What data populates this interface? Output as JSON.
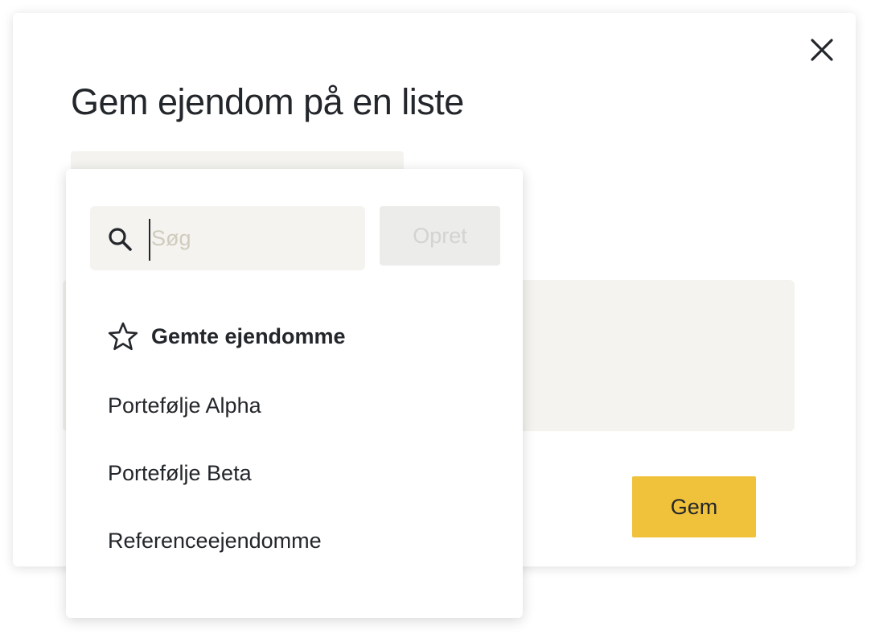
{
  "modal": {
    "title": "Gem ejendom på en liste",
    "close_icon": "close-icon",
    "save_label": "Gem"
  },
  "dropdown": {
    "search": {
      "placeholder": "Søg",
      "value": "",
      "icon": "search-icon"
    },
    "create_label": "Opret",
    "lists": [
      {
        "label": "Gemte ejendomme",
        "icon": "star-icon",
        "favorite": true
      },
      {
        "label": "Portefølje Alpha"
      },
      {
        "label": "Portefølje Beta"
      },
      {
        "label": "Referenceejendomme"
      }
    ]
  },
  "colors": {
    "accent_button": "#f0c13b",
    "field_background": "#f4f3ef",
    "text": "#23262a",
    "disabled_button": "#ececeb"
  }
}
